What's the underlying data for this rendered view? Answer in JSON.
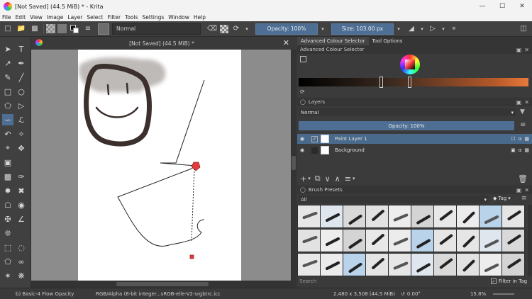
{
  "window": {
    "title": "[Not Saved]  (44.5 MiB) * - Krita",
    "minimize_icon": "minimize-icon",
    "maximize_icon": "maximize-icon",
    "close_icon": "close-icon"
  },
  "menu": [
    "File",
    "Edit",
    "View",
    "Image",
    "Layer",
    "Select",
    "Filter",
    "Tools",
    "Settings",
    "Window",
    "Help"
  ],
  "toolbar": {
    "blend_mode": "Normal",
    "opacity_label": "Opacity: 100%",
    "size_label": "Size: 103.00 px"
  },
  "canvas": {
    "tab_title": "[Not Saved]  (44.5 MiB) *"
  },
  "docker_tabs": {
    "active": "Advanced Colour Selector",
    "other": "Tool Options"
  },
  "colour_selector": {
    "title": "Advanced Colour Selector"
  },
  "layers": {
    "title": "Layers",
    "blend_mode": "Normal",
    "opacity_label": "Opacity:  100%",
    "items": [
      {
        "name": "Paint Layer 1",
        "selected": true
      },
      {
        "name": "Background",
        "selected": false
      }
    ]
  },
  "brush_presets": {
    "title": "Brush Presets",
    "filter": "All",
    "tag_label": "Tag",
    "search_placeholder": "Search",
    "filter_in_tag": "Filter in Tag",
    "filter_in_tag_checked": true
  },
  "status": {
    "brush": "b) Basic-4 Flow Opacity",
    "colorspace": "RGB/Alpha (8-bit integer...sRGB-elle-V2-srgbtrc.icc",
    "dimensions": "2,480 x 3,508 (44.5 MiB)",
    "rotation": "0.00°",
    "zoom": "15.8%"
  },
  "colors": {
    "accent": "#4e6e93",
    "selection": "#4a6a8c",
    "fg": "#1a1a1a",
    "bg": "#ffffff"
  }
}
